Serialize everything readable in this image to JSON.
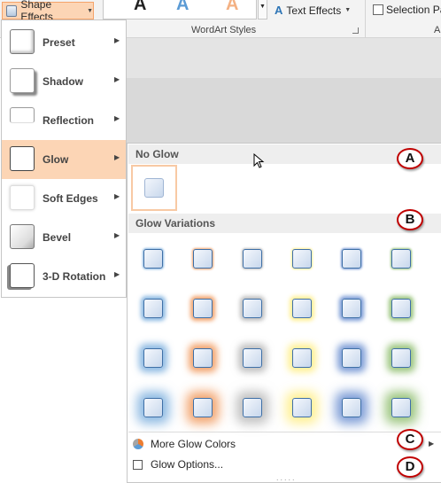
{
  "ribbon": {
    "shape_effects_label": "Shape Effects",
    "gallery_letters": [
      "A",
      "A",
      "A"
    ],
    "text_effects_label": "Text Effects",
    "selection_label": "Selection Pa",
    "group_label": "WordArt Styles",
    "group_label_2": "A"
  },
  "menu": {
    "items": [
      {
        "label": "Preset"
      },
      {
        "label": "Shadow"
      },
      {
        "label": "Reflection"
      },
      {
        "label": "Glow",
        "active": true
      },
      {
        "label": "Soft Edges"
      },
      {
        "label": "Bevel"
      },
      {
        "label": "3-D Rotation"
      }
    ]
  },
  "glow_submenu": {
    "no_glow_heading": "No Glow",
    "variations_heading": "Glow Variations",
    "glow_colors": [
      "#5b9bd5",
      "#ed7d31",
      "#a5a5a5",
      "#ffe966",
      "#4472c4",
      "#70ad47"
    ],
    "glow_sizes": [
      2,
      5,
      8,
      12
    ],
    "more_colors_label": "More Glow Colors",
    "options_label": "Glow Options...",
    "grip": "....."
  },
  "callouts": [
    "A",
    "B",
    "C",
    "D"
  ],
  "colors": {
    "accent_hover": "#fcd5b5",
    "accent_border": "#f4a46a",
    "callout_red": "#c00000"
  }
}
